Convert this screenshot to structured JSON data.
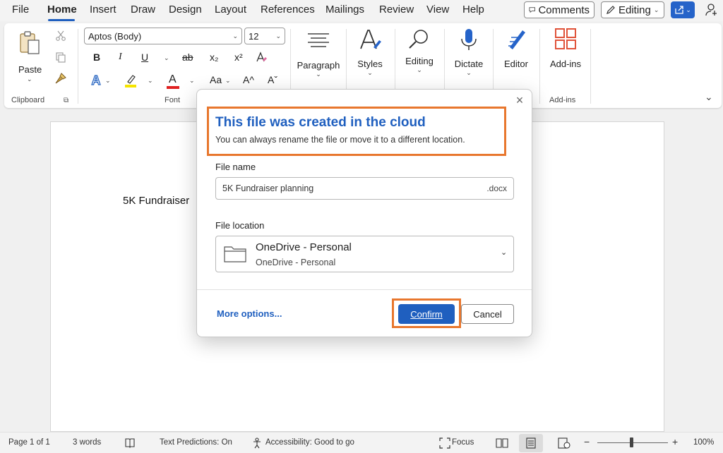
{
  "menu": {
    "tabs": [
      "File",
      "Home",
      "Insert",
      "Draw",
      "Design",
      "Layout",
      "References",
      "Mailings",
      "Review",
      "View",
      "Help"
    ],
    "active_tab": "Home",
    "comments_label": "Comments",
    "editing_label": "Editing"
  },
  "ribbon": {
    "clipboard": {
      "paste_label": "Paste",
      "group_label": "Clipboard"
    },
    "font": {
      "font_name": "Aptos (Body)",
      "font_size": "12",
      "bold": "B",
      "italic": "I",
      "underline": "U",
      "strikethrough": "ab",
      "subscript": "x₂",
      "superscript": "x²",
      "font_color_glyph": "A",
      "change_case": "Aa",
      "grow_font": "A^",
      "shrink_font": "Aˇ",
      "group_label": "Font"
    },
    "paragraph_label": "Paragraph",
    "styles_label": "Styles",
    "editing_label": "Editing",
    "dictate_label": "Dictate",
    "editor_label": "Editor",
    "addins_label": "Add-ins",
    "addins_group_label": "Add-ins"
  },
  "document": {
    "text": "5K Fundraiser"
  },
  "dialog": {
    "title": "This file was created in the cloud",
    "subtitle": "You can always rename the file or move it to a different location.",
    "file_name_label": "File name",
    "file_name_value": "5K Fundraiser planning",
    "file_extension": ".docx",
    "file_location_label": "File location",
    "location_main": "OneDrive - Personal",
    "location_sub": "OneDrive - Personal",
    "more_options": "More options...",
    "confirm": "Confirm",
    "cancel": "Cancel",
    "highlight_color": "#e8772e",
    "accent_color": "#1f5fbf"
  },
  "status": {
    "page": "Page 1 of 1",
    "words": "3 words",
    "text_predictions": "Text Predictions: On",
    "accessibility": "Accessibility: Good to go",
    "focus": "Focus",
    "zoom_minus": "−",
    "zoom_plus": "+",
    "zoom": "100%",
    "zoom_slider_fraction": 0.5
  }
}
